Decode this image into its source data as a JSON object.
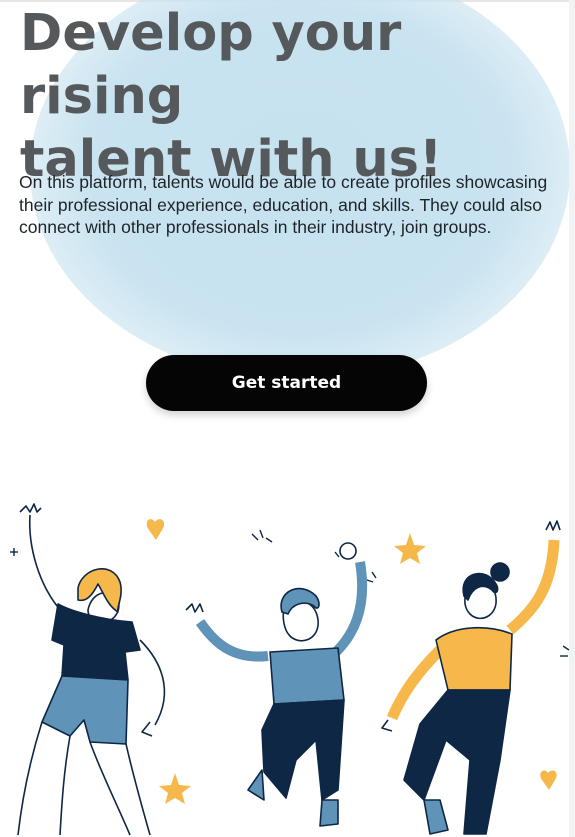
{
  "hero": {
    "title_line1": "Develop your rising",
    "title_line2": "talent with us!",
    "description": "On this platform, talents would be able to create profiles showcasing their professional experience, education, and skills. They could also connect with other professionals in their industry, join groups.",
    "cta_label": "Get started"
  },
  "colors": {
    "accent_yellow": "#f6b84a",
    "navy": "#0e2744",
    "steel_blue": "#5f93b8",
    "blob": "#c9e3f0",
    "title": "#56595b",
    "button": "#050505"
  },
  "illustration": {
    "people": [
      "person-left",
      "person-middle",
      "person-right"
    ],
    "decor_icons": [
      "heart-icon",
      "star-icon"
    ]
  }
}
